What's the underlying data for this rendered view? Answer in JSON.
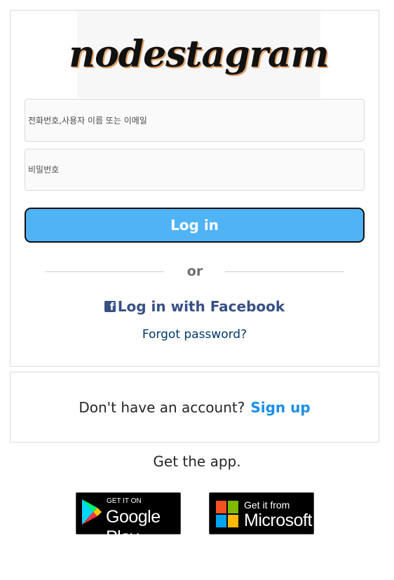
{
  "logo": {
    "text": "nodestagram"
  },
  "login": {
    "username_placeholder": "전화번호,사용자 이름 또는 이메일",
    "password_placeholder": "비밀번호",
    "login_button": "Log in",
    "divider_text": "or",
    "facebook_login": "Log in with Facebook",
    "forgot_password": "Forgot password?"
  },
  "signup": {
    "prompt": "Don't have an account?",
    "link": "Sign up"
  },
  "app": {
    "title": "Get the app.",
    "google_play": {
      "small": "GET IT ON",
      "big": "Google Play"
    },
    "microsoft": {
      "small": "Get it from",
      "big": "Microsoft"
    }
  },
  "colors": {
    "login_button": "#4fb3f6",
    "facebook": "#385185",
    "signup_link": "#1a8fe8",
    "ms_red": "#f25022",
    "ms_green": "#7fba00",
    "ms_blue": "#00a4ef",
    "ms_yellow": "#ffb900"
  },
  "icons": [
    "facebook-icon",
    "google-play-icon",
    "microsoft-icon"
  ]
}
